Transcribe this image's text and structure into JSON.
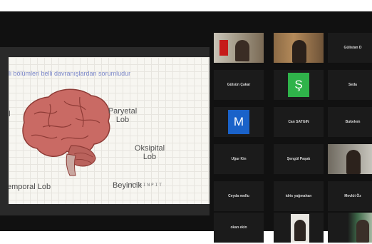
{
  "slide": {
    "title": "ili bölümleri belli davranışlardan sorumludur",
    "labels": {
      "partial_left": "al",
      "parietal_line1": "Paryetal",
      "parietal_line2": "Lob",
      "occipital_line1": "Oksipital",
      "occipital_line2": "Lob",
      "temporal": "emporal Lob",
      "cerebellum": "Beyincik"
    },
    "brand": "BRAINPIT"
  },
  "participants": [
    {
      "name": "",
      "type": "video",
      "active": true
    },
    {
      "name": "",
      "type": "video"
    },
    {
      "name": "Gülistan D",
      "type": "name"
    },
    {
      "name": "Gülsün Çakar",
      "type": "name"
    },
    {
      "name": "",
      "type": "avatar",
      "letter": "Ş",
      "color": "#2fb34a"
    },
    {
      "name": "Seda",
      "type": "name"
    },
    {
      "name": "",
      "type": "avatar",
      "letter": "M",
      "color": "#1a62c9"
    },
    {
      "name": "Can SATGIN",
      "type": "name"
    },
    {
      "name": "Bukelem",
      "type": "name"
    },
    {
      "name": "Uğur Kin",
      "type": "name"
    },
    {
      "name": "Şengül Paşak",
      "type": "name"
    },
    {
      "name": "",
      "type": "video"
    },
    {
      "name": "Ceyda mollu",
      "type": "name"
    },
    {
      "name": "idris yağmahan",
      "type": "name"
    },
    {
      "name": "Mevlüt Öz",
      "type": "name"
    },
    {
      "name": "okan ekin",
      "type": "name"
    },
    {
      "name": "",
      "type": "video"
    },
    {
      "name": "",
      "type": "video"
    }
  ]
}
